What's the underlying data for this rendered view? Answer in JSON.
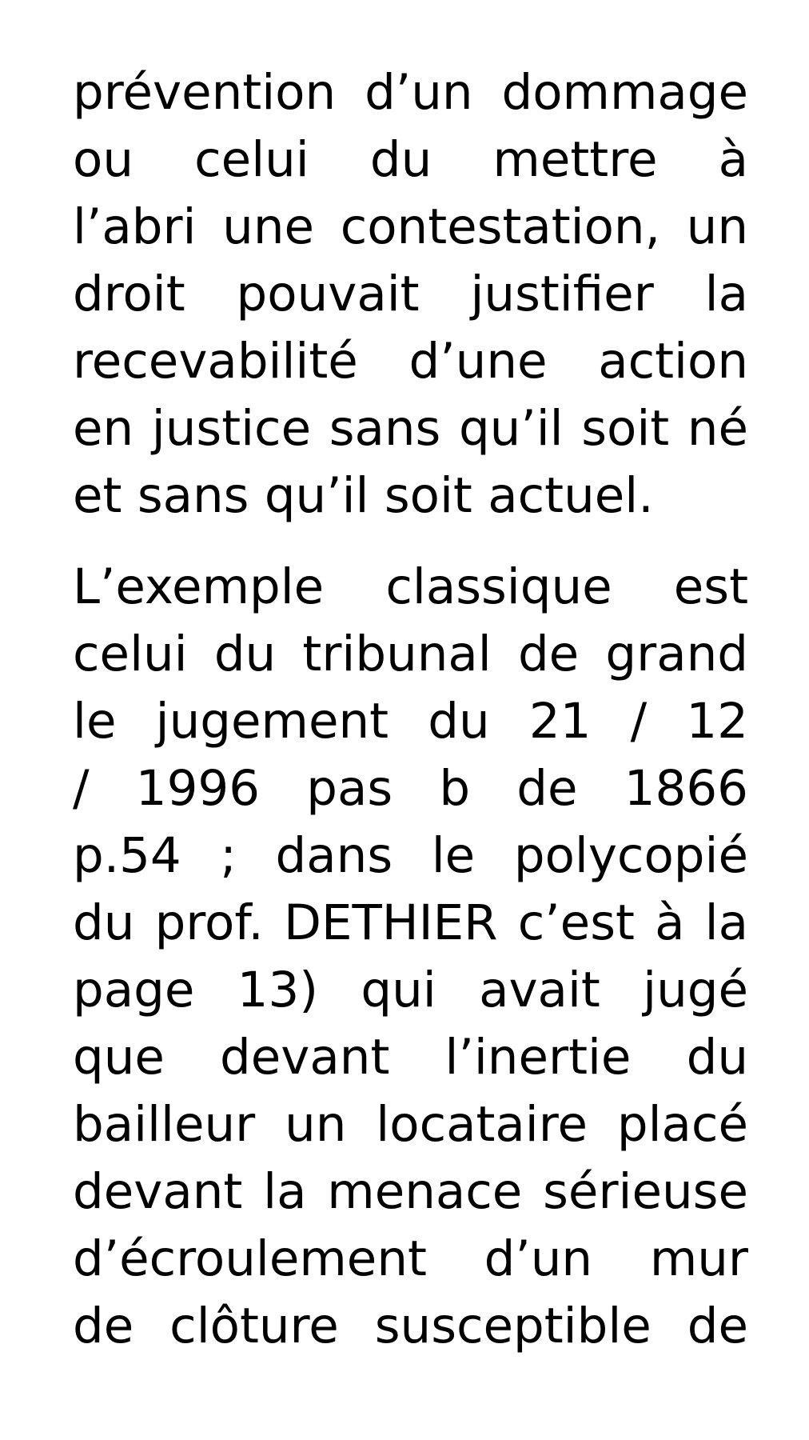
{
  "document": {
    "paragraphs": [
      {
        "lines": [
          "prévention d’un  dommage",
          "ou celui du mettre à",
          "l’abri une contestation, un",
          "droit pouvait justifier la",
          "recevabilité d’une action",
          "en justice sans qu’il soit né",
          "et sans qu’il soit actuel."
        ]
      },
      {
        "lines": [
          "L’exemple classique est",
          "celui du tribunal de grand",
          "le jugement du 21 / 12",
          "/ 1996 pas b de  1866",
          "p.54 ; dans le polycopié",
          "du prof. DETHIER c’est à la",
          "page 13) qui avait jugé",
          "que devant l’inertie du",
          "bailleur un locataire placé",
          "devant la menace sérieuse",
          "d’écroulement d’un mur",
          "de clôture susceptible de"
        ]
      }
    ]
  }
}
